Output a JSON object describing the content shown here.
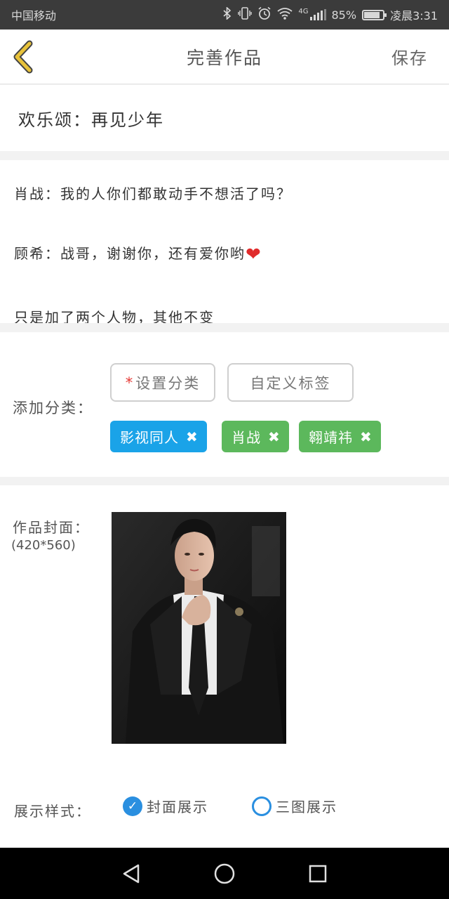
{
  "status_bar": {
    "carrier": "中国移动",
    "network": "4G",
    "battery": "85%",
    "battery_level": 0.85,
    "time": "凌晨3:31"
  },
  "nav": {
    "title": "完善作品",
    "save_label": "保存",
    "back_icon": "chevron-left-icon"
  },
  "work_title": "欢乐颂：再见少年",
  "content": {
    "lines": [
      "肖战：我的人你们都敢动手不想活了吗？",
      "顾希：战哥，谢谢你，还有爱你哟",
      "只是加了两个人物，其他不变"
    ],
    "heart_emoji": "❤"
  },
  "category": {
    "label": "添加分类：",
    "required_mark": "*",
    "set_category_button": "设置分类",
    "custom_tag_button": "自定义标签",
    "tags": [
      {
        "label": "影视同人",
        "color": "#1aa3e8"
      },
      {
        "label": "肖战",
        "color": "#5cb85c"
      },
      {
        "label": "翱靖祎",
        "color": "#5cb85c"
      }
    ],
    "remove_glyph": "✖"
  },
  "cover": {
    "label": "作品封面：",
    "size_hint": "(420*560)"
  },
  "display_style": {
    "label": "展示样式：",
    "options": [
      {
        "label": "封面展示",
        "selected": true
      },
      {
        "label": "三图展示",
        "selected": false
      }
    ]
  },
  "colors": {
    "accent": "#2a8fe0",
    "back_arrow": "#e8c23a",
    "status_bar_bg": "#3b3b3b"
  }
}
